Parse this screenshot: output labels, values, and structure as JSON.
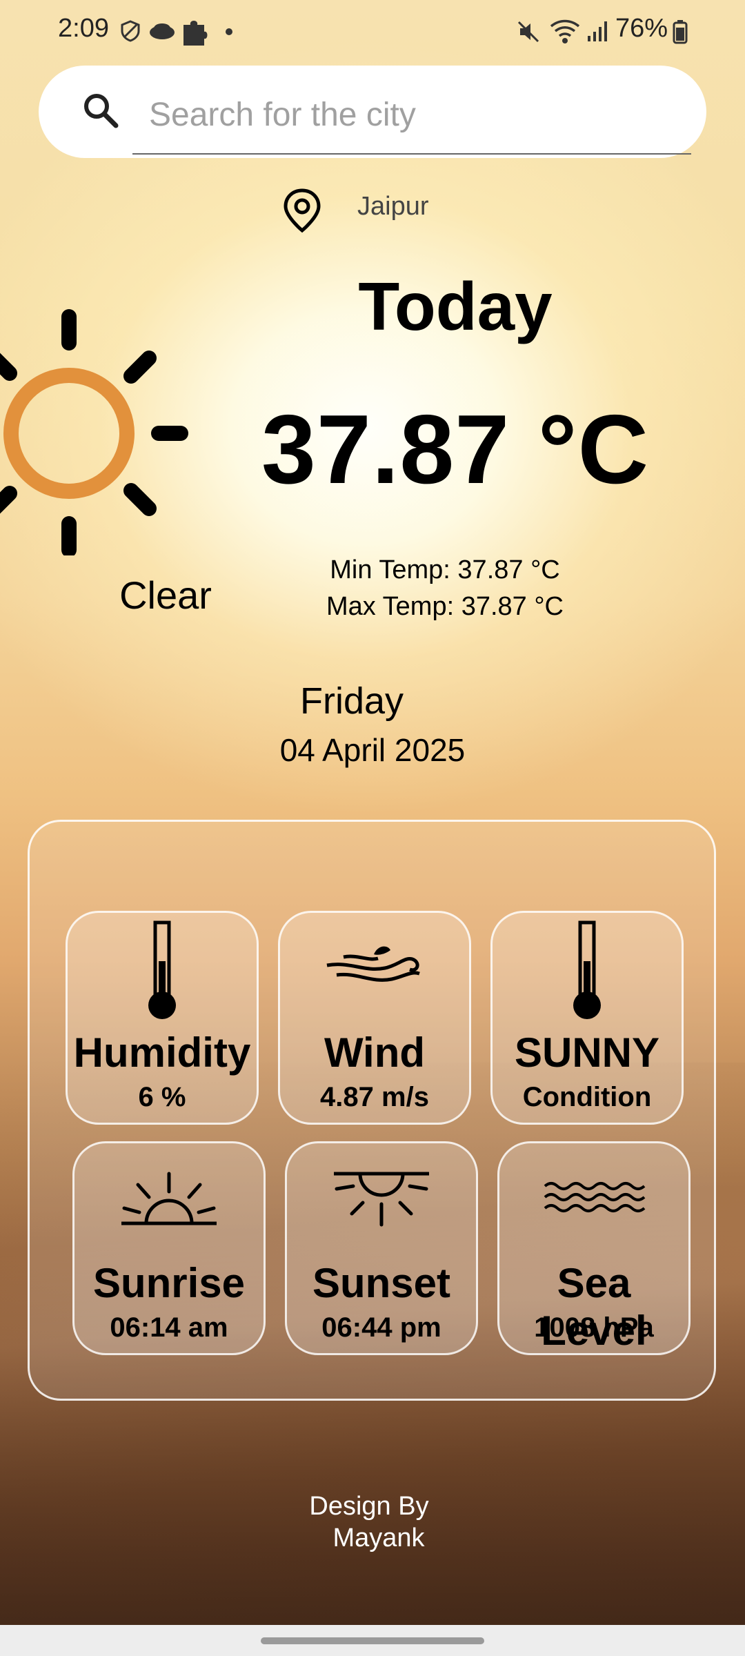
{
  "status_bar": {
    "time": "2:09",
    "battery": "76%"
  },
  "search": {
    "placeholder": "Search for the city",
    "value": ""
  },
  "location": {
    "city": "Jaipur"
  },
  "weather": {
    "heading": "Today",
    "temperature": "37.87 °C",
    "condition": "Clear",
    "min_temp": "Min Temp: 37.87 °C",
    "max_temp": "Max Temp: 37.87 °C",
    "day": "Friday",
    "date": "04 April 2025"
  },
  "stats": [
    {
      "title": "Humidity",
      "value": "6 %",
      "icon": "thermometer-icon"
    },
    {
      "title": "Wind",
      "value": "4.87 m/s",
      "icon": "wind-icon"
    },
    {
      "title": "SUNNY",
      "value": "Condition",
      "icon": "thermometer-icon"
    },
    {
      "title": "Sunrise",
      "value": "06:14 am",
      "icon": "sunrise-icon"
    },
    {
      "title": "Sunset",
      "value": "06:44 pm",
      "icon": "sunset-icon"
    },
    {
      "title": "Sea Level",
      "value": "1008 hPa",
      "icon": "waves-icon"
    }
  ],
  "footer": {
    "line1": "Design By",
    "line2": "Mayank"
  },
  "colors": {
    "sun_ring": "#e2913c",
    "ink": "#000000"
  }
}
